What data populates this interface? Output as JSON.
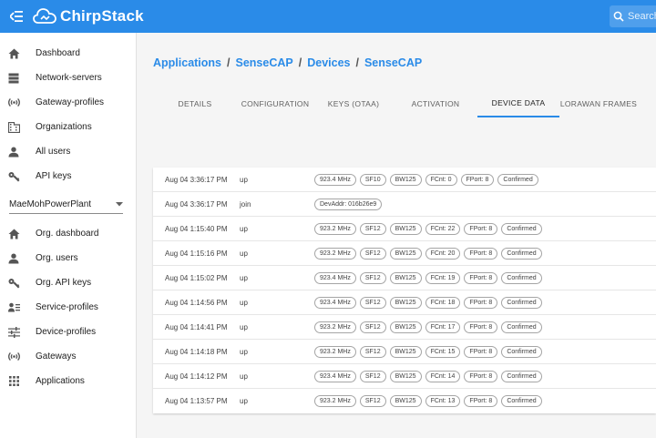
{
  "app": {
    "logo_text": "ChirpStack"
  },
  "search": {
    "placeholder": "Search"
  },
  "sidebar": {
    "global_items": [
      {
        "label": "Dashboard",
        "icon": "home-icon"
      },
      {
        "label": "Network-servers",
        "icon": "server-icon"
      },
      {
        "label": "Gateway-profiles",
        "icon": "radio-tower-icon"
      },
      {
        "label": "Organizations",
        "icon": "building-icon"
      },
      {
        "label": "All users",
        "icon": "user-icon"
      },
      {
        "label": "API keys",
        "icon": "key-icon"
      }
    ],
    "org_select": {
      "value": "MaeMohPowerPlant"
    },
    "org_items": [
      {
        "label": "Org. dashboard",
        "icon": "home-icon"
      },
      {
        "label": "Org. users",
        "icon": "user-icon"
      },
      {
        "label": "Org. API keys",
        "icon": "key-icon"
      },
      {
        "label": "Service-profiles",
        "icon": "service-profile-icon"
      },
      {
        "label": "Device-profiles",
        "icon": "sliders-icon"
      },
      {
        "label": "Gateways",
        "icon": "radio-tower-icon"
      },
      {
        "label": "Applications",
        "icon": "grid-icon"
      }
    ]
  },
  "breadcrumb": {
    "items": [
      "Applications",
      "SenseCAP",
      "Devices",
      "SenseCAP"
    ],
    "separator": "/"
  },
  "tabs": [
    {
      "label": "DETAILS",
      "active": false
    },
    {
      "label": "CONFIGURATION",
      "active": false
    },
    {
      "label": "KEYS (OTAA)",
      "active": false
    },
    {
      "label": "ACTIVATION",
      "active": false
    },
    {
      "label": "DEVICE DATA",
      "active": true
    },
    {
      "label": "LORAWAN FRAMES",
      "active": false
    }
  ],
  "frames": [
    {
      "time": "Aug 04 3:36:17 PM",
      "type": "up",
      "tags": [
        "923.4 MHz",
        "SF10",
        "BW125",
        "FCnt: 0",
        "FPort: 8",
        "Confirmed"
      ]
    },
    {
      "time": "Aug 04 3:36:17 PM",
      "type": "join",
      "tags": [
        "DevAddr: 016b26e9"
      ]
    },
    {
      "time": "Aug 04 1:15:40 PM",
      "type": "up",
      "tags": [
        "923.2 MHz",
        "SF12",
        "BW125",
        "FCnt: 22",
        "FPort: 8",
        "Confirmed"
      ]
    },
    {
      "time": "Aug 04 1:15:16 PM",
      "type": "up",
      "tags": [
        "923.2 MHz",
        "SF12",
        "BW125",
        "FCnt: 20",
        "FPort: 8",
        "Confirmed"
      ]
    },
    {
      "time": "Aug 04 1:15:02 PM",
      "type": "up",
      "tags": [
        "923.4 MHz",
        "SF12",
        "BW125",
        "FCnt: 19",
        "FPort: 8",
        "Confirmed"
      ]
    },
    {
      "time": "Aug 04 1:14:56 PM",
      "type": "up",
      "tags": [
        "923.4 MHz",
        "SF12",
        "BW125",
        "FCnt: 18",
        "FPort: 8",
        "Confirmed"
      ]
    },
    {
      "time": "Aug 04 1:14:41 PM",
      "type": "up",
      "tags": [
        "923.2 MHz",
        "SF12",
        "BW125",
        "FCnt: 17",
        "FPort: 8",
        "Confirmed"
      ]
    },
    {
      "time": "Aug 04 1:14:18 PM",
      "type": "up",
      "tags": [
        "923.2 MHz",
        "SF12",
        "BW125",
        "FCnt: 15",
        "FPort: 8",
        "Confirmed"
      ]
    },
    {
      "time": "Aug 04 1:14:12 PM",
      "type": "up",
      "tags": [
        "923.4 MHz",
        "SF12",
        "BW125",
        "FCnt: 14",
        "FPort: 8",
        "Confirmed"
      ]
    },
    {
      "time": "Aug 04 1:13:57 PM",
      "type": "up",
      "tags": [
        "923.2 MHz",
        "SF12",
        "BW125",
        "FCnt: 13",
        "FPort: 8",
        "Confirmed"
      ]
    }
  ],
  "colors": {
    "primary": "#2a8be8",
    "sidebar_bg": "#ffffff",
    "content_bg": "#f5f5f5"
  }
}
